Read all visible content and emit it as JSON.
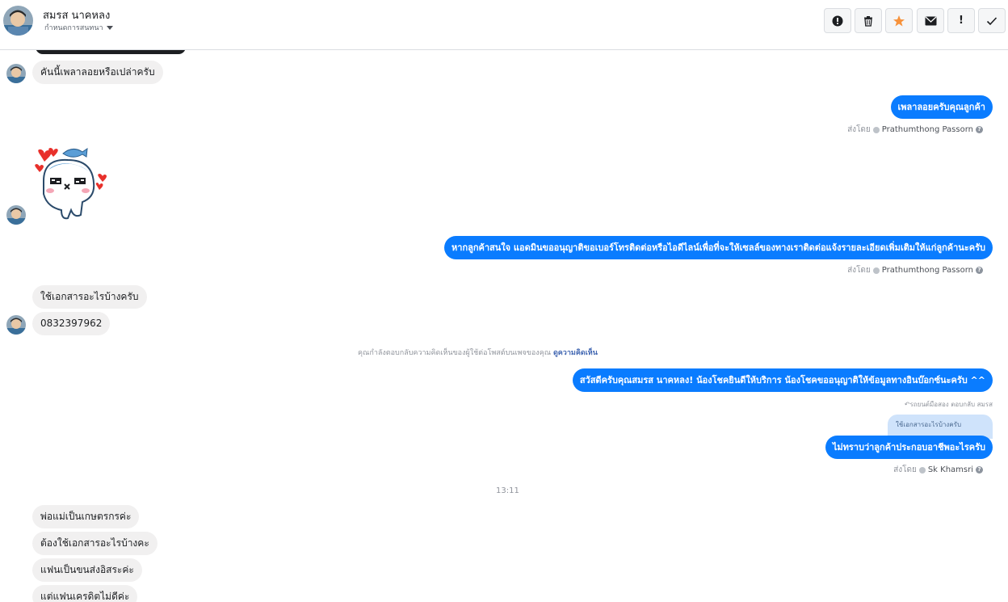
{
  "header": {
    "contact_name": "สมรส นาคหลง",
    "assign_label": "กำหนดการสนทนา",
    "toolbar": [
      "alert-icon",
      "trash-icon",
      "star-icon",
      "mail-icon",
      "exclamation-icon",
      "check-icon"
    ],
    "toolbar_text": {
      "exclaim": "!"
    },
    "star_color": "#f7923b"
  },
  "messages": {
    "m1": "คันนี้เพลาลอยหรือเปล่าครับ",
    "m2": "เพลาลอยครับคุณลูกค้า",
    "m3": "หากลูกค้าสนใจ แอดมินขออนุญาติขอเบอร์โทรติดต่อหรือไอดีไลน์เพื่อที่จะให้เซลล์ของทางเราติดต่อแจ้งรายละเอียดเพิ่มเติมให้แก่ลูกค้านะครับ",
    "m4": "ใช้เอกสารอะไรบ้างครับ",
    "m5": "0832397962",
    "m6": "สวัสดีครับคุณสมรส นาคหลง! น้องโชคยินดีให้บริการ น้องโชคขออนุญาติให้ข้อมูลทางอินบ๊อกซ์นะครับ ^^",
    "reply_quote": "ใช้เอกสารอะไรบ้างครับ",
    "m7": "ไม่ทราบว่าลูกค้าประกอบอาชีพอะไรครับ",
    "m8": "พ่อแม่เป็นเกษตรกรค่ะ",
    "m9": "ต้องใช้เอกสารอะไรบ้างคะ",
    "m10": "แฟนเป็นขนส่งอิสระค่ะ",
    "m11": "แต่แฟนเครดิตไม่ดีค่ะ"
  },
  "sent_by": {
    "prefix": "ส่งโดย",
    "agent1": "Prathumthong Passorn",
    "agent2": "Sk Khamsri",
    "help": "?"
  },
  "notes": {
    "comment_reply": "คุณกำลังตอบกลับความคิดเห็นของผู้ใช้ต่อโพสต์บนเพจของคุณ",
    "view_comment": "ดูความคิดเห็น",
    "replied_to": "↶รถยนต์มือสอง ตอบกลับ สมรส",
    "time": "13:11"
  },
  "colors": {
    "outgoing_bubble": "#0a7cff",
    "incoming_bubble": "#f1f0f0",
    "quote_bubble": "#cfe3fb"
  }
}
